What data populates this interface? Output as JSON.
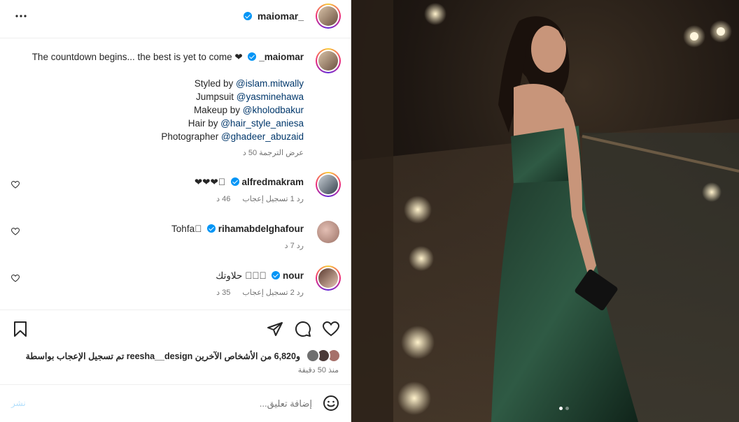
{
  "header": {
    "username": "maiomar_",
    "more_icon": "ellipsis-icon"
  },
  "caption": {
    "text": "The countdown begins... the best is yet to come ❤",
    "username": "_maiomar",
    "lines": [
      {
        "label": "Styled by ",
        "handle": "@islam.mitwally"
      },
      {
        "label": "Jumpsuit ",
        "handle": "@yasminehawa"
      },
      {
        "label": "Makeup by ",
        "handle": "@kholodbakur"
      },
      {
        "label": "Hair by ",
        "handle": "@hair_style_aniesa"
      },
      {
        "label": "Photographer ",
        "handle": "@ghadeer_abuzaid"
      }
    ],
    "time": "50 د",
    "see_translation": "عرض الترجمة"
  },
  "comments": [
    {
      "username": "alfredmakram",
      "text": "❤❤❤􀀀",
      "time": "46 د",
      "likes": "1 تسجيل إعجاب",
      "reply": "رد"
    },
    {
      "username": "rihamabdelghafour",
      "text": "Tohfa􀀀",
      "time": "7 د",
      "likes": "",
      "reply": "رد"
    },
    {
      "username": "nour",
      "text": "حلاوتك 􀀀􀀀􀀀",
      "time": "35 د",
      "likes": "2 تسجيل إعجاب",
      "reply": "رد"
    }
  ],
  "likes": {
    "text": "تم تسجيل الإعجاب بواسطة reesha__design و6,820 من الأشخاص الآخرين",
    "time": "منذ 50 دقيقة"
  },
  "composer": {
    "placeholder": "إضافة تعليق...",
    "post_label": "نشر"
  },
  "colors": {
    "accent": "#0095f6",
    "link": "#00376b",
    "muted": "#737373"
  }
}
